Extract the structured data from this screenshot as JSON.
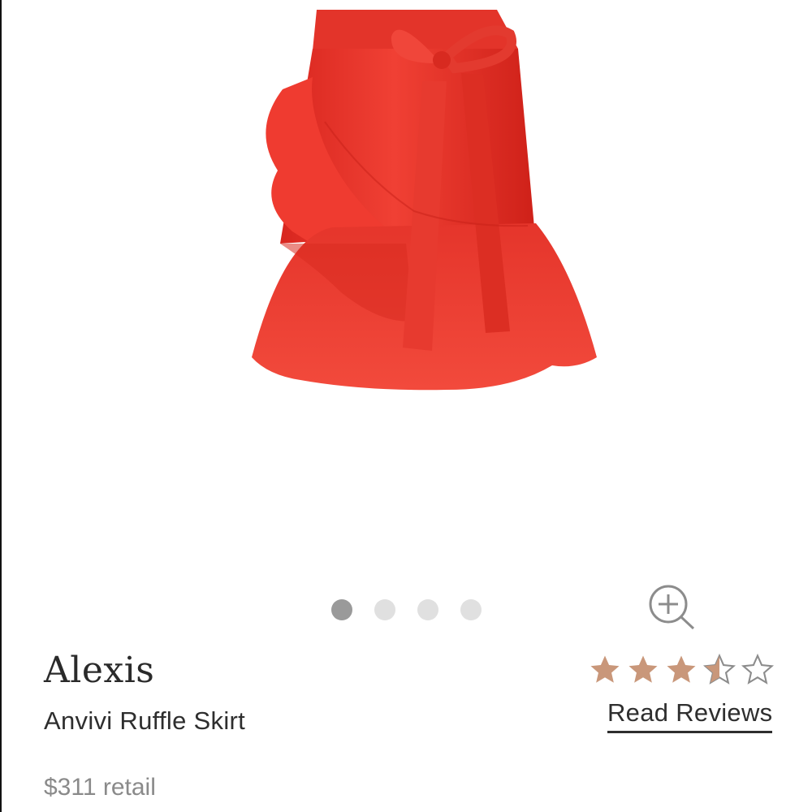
{
  "product": {
    "brand": "Alexis",
    "name": "Anvivi Ruffle Skirt",
    "price": "$311 retail",
    "primary_color": "#e8302c"
  },
  "carousel": {
    "total": 4,
    "active_index": 0
  },
  "rating": {
    "value": 3.5,
    "max": 5,
    "star_color": "#c9977a",
    "reviews_link": "Read Reviews"
  },
  "icons": {
    "zoom": "zoom-in-icon"
  }
}
